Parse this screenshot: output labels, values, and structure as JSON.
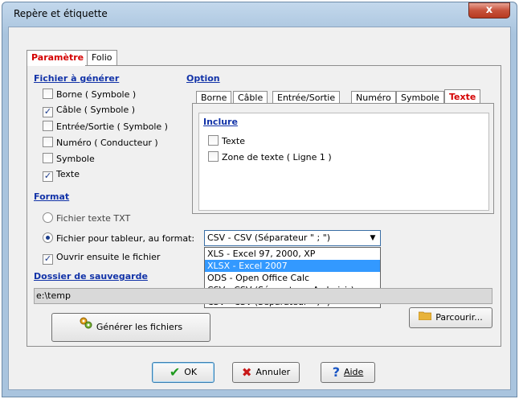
{
  "window": {
    "title": "Repère et étiquette",
    "close_glyph": "x"
  },
  "main_tabs": [
    {
      "label": "Paramètre",
      "active": true
    },
    {
      "label": "Folio",
      "active": false
    }
  ],
  "fichier": {
    "title": "Fichier à générer",
    "items": [
      {
        "label": "Borne ( Symbole )",
        "checked": false
      },
      {
        "label": "Câble ( Symbole )",
        "checked": true
      },
      {
        "label": "Entrée/Sortie ( Symbole )",
        "checked": false
      },
      {
        "label": "Numéro ( Conducteur )",
        "checked": false
      },
      {
        "label": "Symbole",
        "checked": false
      },
      {
        "label": "Texte",
        "checked": true
      }
    ]
  },
  "option": {
    "title": "Option",
    "tabs": [
      {
        "label": "Borne",
        "active": false
      },
      {
        "label": "Câble",
        "active": false
      },
      {
        "label": "Entrée/Sortie",
        "active": false
      },
      {
        "label": "Numéro",
        "active": false
      },
      {
        "label": "Symbole",
        "active": false
      },
      {
        "label": "Texte",
        "active": true
      }
    ],
    "inclure_title": "Inclure",
    "inclure_items": [
      {
        "label": "Texte",
        "checked": false
      },
      {
        "label": "Zone de texte ( Ligne 1 )",
        "checked": false
      }
    ]
  },
  "format": {
    "title": "Format",
    "radio_txt": "Fichier texte TXT",
    "radio_tableur": "Fichier pour tableur, au format:",
    "ouvrir": "Ouvrir ensuite le fichier",
    "combo_value": "CSV - CSV (Séparateur \" ; \")",
    "dropdown_options": [
      "XLS - Excel 97, 2000, XP",
      "XLSX - Excel 2007",
      "ODS - Open Office Calc",
      "CSV - CSV (Séparateur: A choisir)",
      "CSV - CSV (Séparateur \" ; \")"
    ],
    "highlighted_index": 1
  },
  "dossier": {
    "title": "Dossier de sauvegarde",
    "path": "e:\\temp"
  },
  "buttons": {
    "generer": "Générer les fichiers",
    "parcourir": "Parcourir...",
    "ok": "OK",
    "annuler": "Annuler",
    "aide": "Aide"
  },
  "icons": {
    "ok": "check-icon",
    "annuler": "x-icon",
    "aide": "question-icon",
    "parcourir": "folder-icon",
    "generer": "generate-icon"
  },
  "colors": {
    "active_tab": "#d40000",
    "section_title": "#1233a8",
    "selection": "#3399ff"
  }
}
